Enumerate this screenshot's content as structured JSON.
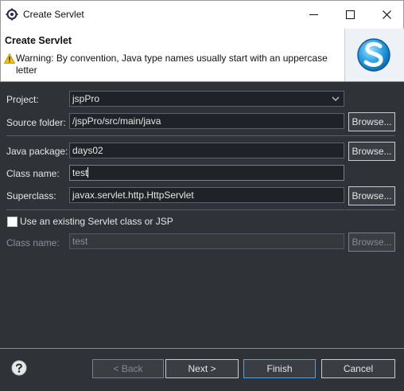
{
  "window": {
    "title": "Create Servlet"
  },
  "banner": {
    "title": "Create Servlet",
    "warning": "Warning: By convention, Java type names usually start with an uppercase letter"
  },
  "form": {
    "project_label": "Project:",
    "project_value": "jspPro",
    "source_folder_label": "Source folder:",
    "source_folder_value": "/jspPro/src/main/java",
    "browse_label": "Browse...",
    "java_package_label": "Java package:",
    "java_package_value": "days02",
    "class_name_label": "Class name:",
    "class_name_value": "test",
    "superclass_label": "Superclass:",
    "superclass_value": "javax.servlet.http.HttpServlet",
    "use_existing_label": "Use an existing Servlet class or JSP",
    "use_existing_checked": false,
    "existing_class_label": "Class name:",
    "existing_class_value": "test"
  },
  "footer": {
    "back_label": "< Back",
    "next_label": "Next >",
    "finish_label": "Finish",
    "cancel_label": "Cancel"
  },
  "colors": {
    "body_bg": "#2f3237",
    "banner_bg": "#ffffff",
    "field_bg": "#1f2226",
    "default_button_border": "#5aa0e0",
    "warning_yellow": "#f5c400"
  },
  "icons": {
    "app": "eclipse-gear-icon",
    "warning": "warning-triangle-icon",
    "logo": "servlet-s-logo-icon",
    "help": "help-question-icon",
    "combo": "chevron-down-icon"
  }
}
